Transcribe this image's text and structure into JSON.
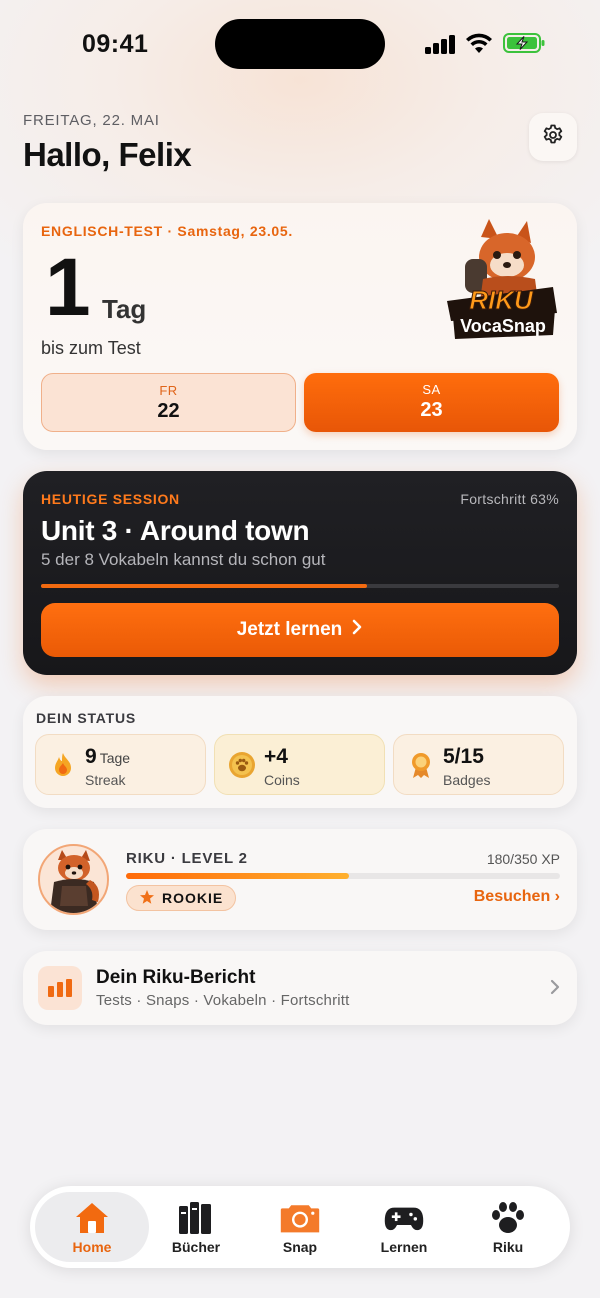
{
  "status_bar": {
    "time": "09:41"
  },
  "header": {
    "date": "FREITAG, 22. MAI",
    "greeting": "Hallo, Felix"
  },
  "test_card": {
    "label": "ENGLISCH-TEST · Samstag, 23.05.",
    "days_number": "1",
    "days_unit": "Tag",
    "subtitle": "bis zum Test",
    "logo_text": "RIKU VocaSnap",
    "days": [
      {
        "weekday": "FR",
        "date": "22",
        "selected": false
      },
      {
        "weekday": "SA",
        "date": "23",
        "selected": true
      }
    ]
  },
  "session": {
    "label": "HEUTIGE SESSION",
    "progress_text": "Fortschritt 63%",
    "progress": 0.63,
    "title": "Unit 3 · Around town",
    "subtitle": "5 der 8 Vokabeln kannst du schon gut",
    "button_label": "Jetzt lernen",
    "accent": "#f26a10"
  },
  "status": {
    "title": "DEIN STATUS",
    "items": [
      {
        "value": "9",
        "unit": "Tage",
        "label": "Streak",
        "icon": "flame-icon"
      },
      {
        "value": "+4",
        "unit": "",
        "label": "Coins",
        "icon": "paw-coin-icon"
      },
      {
        "value": "5/15",
        "unit": "",
        "label": "Badges",
        "icon": "award-icon"
      }
    ]
  },
  "riku": {
    "level": "RIKU · LEVEL 2",
    "xp": "180/350 XP",
    "xp_fraction": 0.514,
    "rank": "ROOKIE",
    "visit": "Besuchen ›"
  },
  "report": {
    "title": "Dein Riku-Bericht",
    "subtitle": "Tests · Snaps · Vokabeln · Fortschritt"
  },
  "tabs": [
    {
      "label": "Home",
      "icon": "home-icon",
      "active": true
    },
    {
      "label": "Bücher",
      "icon": "books-icon",
      "active": false
    },
    {
      "label": "Snap",
      "icon": "camera-icon",
      "active": false
    },
    {
      "label": "Lernen",
      "icon": "gamepad-icon",
      "active": false
    },
    {
      "label": "Riku",
      "icon": "paw-icon",
      "active": false
    }
  ],
  "colors": {
    "accent": "#e8650f",
    "dark_card": "#1c1c1f",
    "background": "#f3f2f4"
  }
}
